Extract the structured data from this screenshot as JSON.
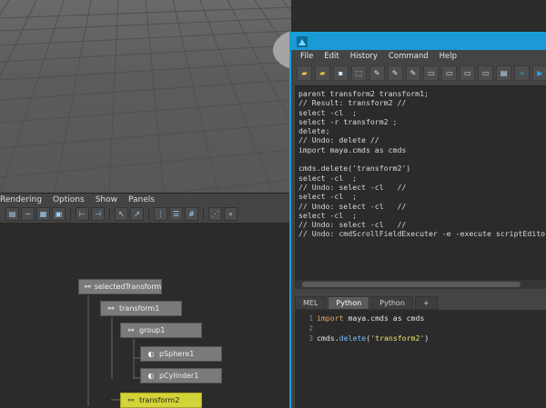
{
  "node_editor": {
    "menu": [
      "Rendering",
      "Options",
      "Show",
      "Panels"
    ],
    "nodes": [
      {
        "label": "selectedTransform"
      },
      {
        "label": "transform1"
      },
      {
        "label": "group1"
      },
      {
        "label": "pSphere1"
      },
      {
        "label": "pCylinder1"
      },
      {
        "label": "transform2"
      }
    ]
  },
  "script_editor": {
    "menu": [
      "File",
      "Edit",
      "History",
      "Command",
      "Help"
    ],
    "history": "parent transform2 transform1;\n// Result: transform2 //\nselect -cl  ;\nselect -r transform2 ;\ndelete;\n// Undo: delete //\nimport maya.cmds as cmds\n\ncmds.delete('transform2')\nselect -cl  ;\n// Undo: select -cl   //\nselect -cl  ;\n// Undo: select -cl   //\nselect -cl  ;\n// Undo: select -cl   //\n// Undo: cmdScrollFieldExecuter -e -execute scriptEdito",
    "tabs": [
      "MEL",
      "Python",
      "Python",
      "+"
    ],
    "line_numbers": "1\n2\n3",
    "code": {
      "l1_kw": "import",
      "l1_rest": " maya.cmds as cmds",
      "l3_a": "cmds.",
      "l3_fn": "delete",
      "l3_b": "(",
      "l3_str": "'transform2'",
      "l3_c": ")"
    }
  },
  "colors": {
    "accent": "#1b9ad6",
    "selected_node": "#d3d33a"
  }
}
